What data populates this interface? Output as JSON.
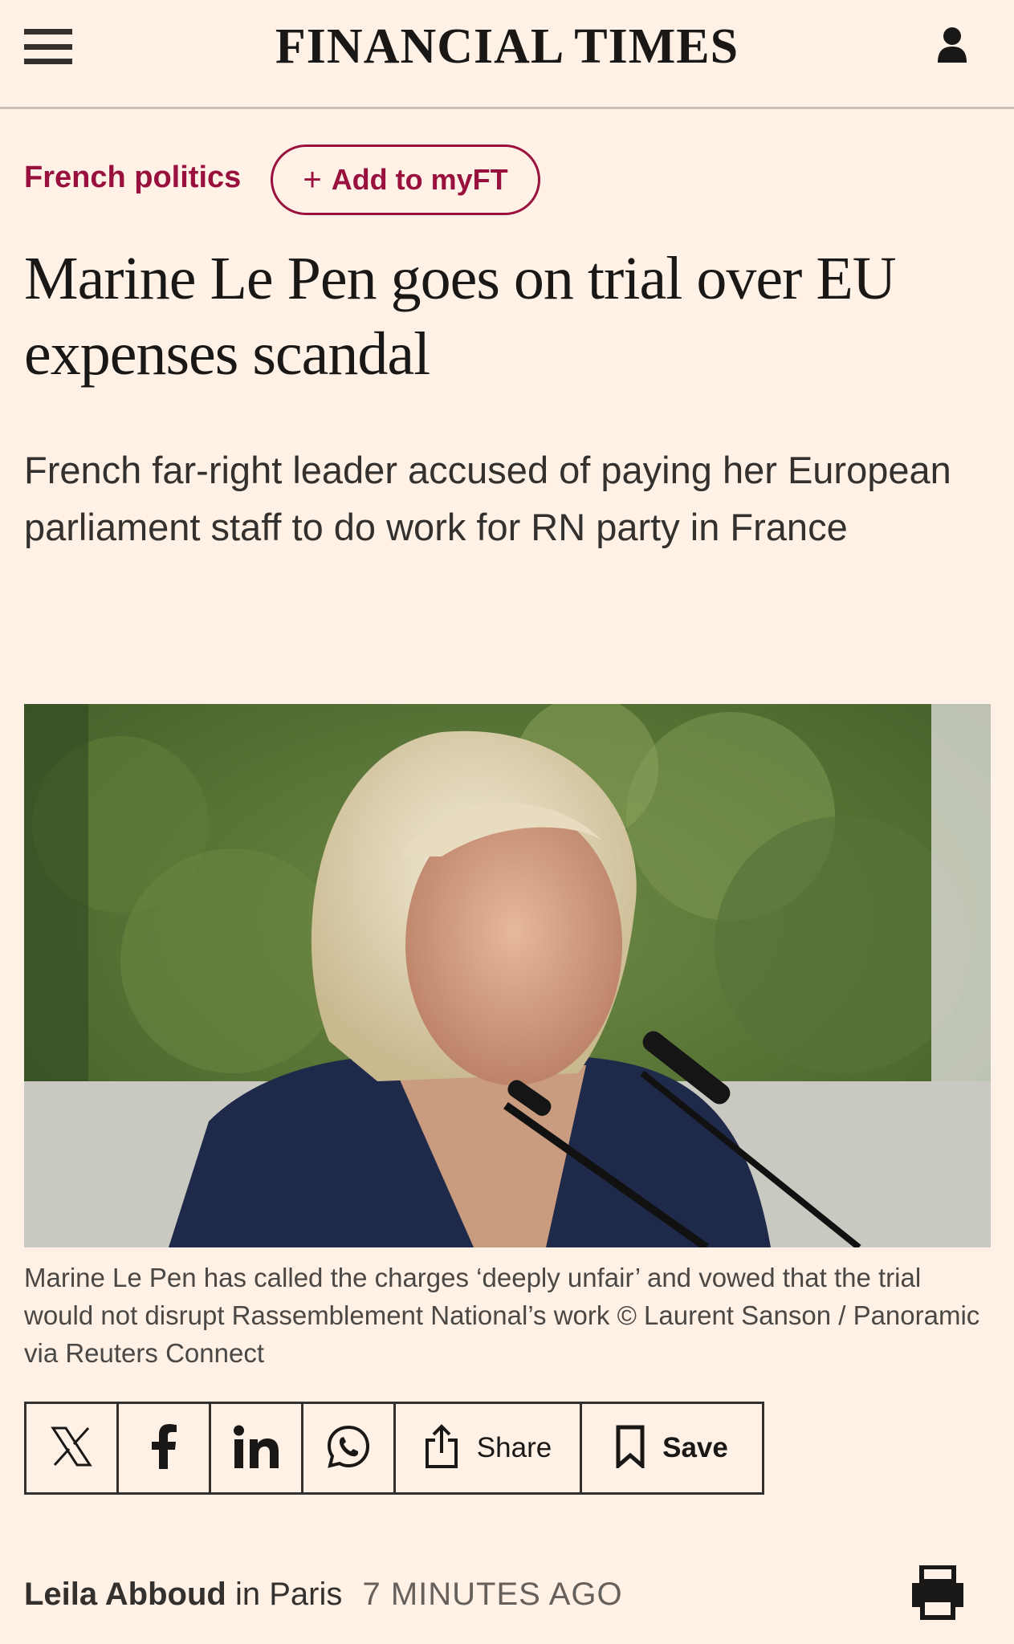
{
  "header": {
    "masthead": "FINANCIAL TIMES",
    "menu_icon": "hamburger-menu-icon",
    "user_icon": "user-account-icon"
  },
  "topic": {
    "label": "French politics",
    "add_button": "+ Add to myFT",
    "add_plus": "+",
    "add_text": "Add to myFT"
  },
  "article": {
    "headline": "Marine Le Pen goes on trial over EU expenses scandal",
    "standfirst": "French far-right leader accused of paying her European parliament staff to do work for RN party in France",
    "image_caption": "Marine Le Pen has called the charges ‘deeply unfair’ and vowed that the trial would not disrupt Rassemblement National’s work © Laurent Sanson / Panoramic via Reuters Connect"
  },
  "share_bar": {
    "items": [
      {
        "icon": "x-twitter-icon"
      },
      {
        "icon": "facebook-icon"
      },
      {
        "icon": "linkedin-icon"
      },
      {
        "icon": "whatsapp-icon"
      },
      {
        "icon": "share-icon",
        "label": "Share"
      },
      {
        "icon": "bookmark-icon",
        "label": "Save"
      }
    ]
  },
  "byline": {
    "author": "Leila Abboud",
    "location": "in Paris",
    "time": "7 MINUTES AGO",
    "print_icon": "printer-icon"
  },
  "colors": {
    "background": "#fff1e5",
    "accent": "#990f3d",
    "text": "#1a1817"
  }
}
